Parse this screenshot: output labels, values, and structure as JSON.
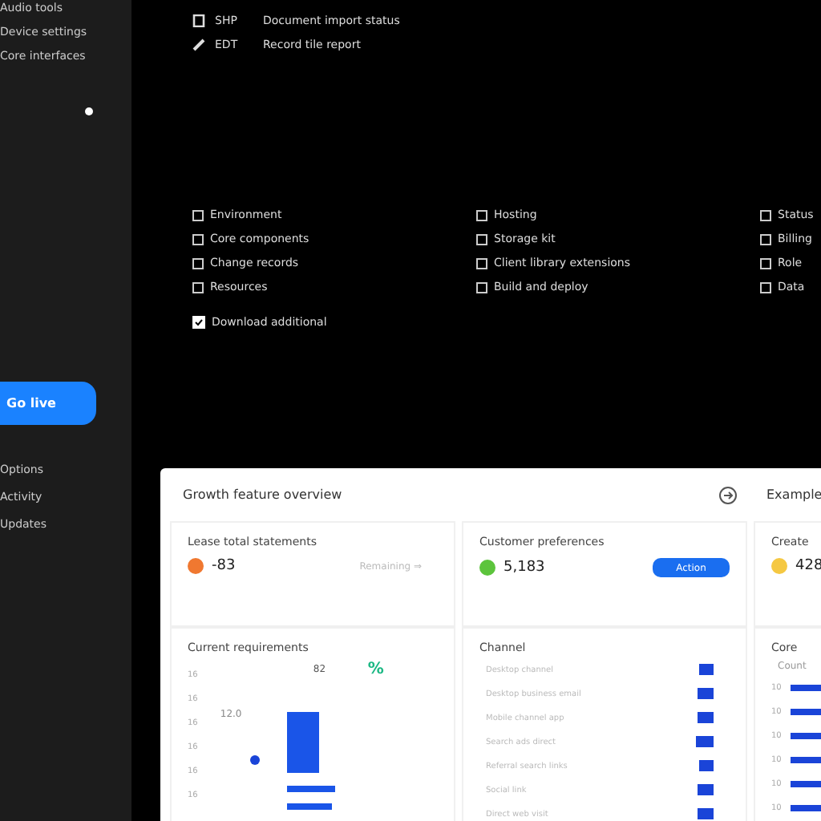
{
  "sidebar": {
    "top_items": [
      "Audio tools",
      "Device settings",
      "Core interfaces"
    ],
    "primary_button": "Go live",
    "bottom_items": [
      "Options",
      "Activity",
      "Updates"
    ]
  },
  "header_rows": [
    {
      "kind": "doc",
      "code": "SHP",
      "label": "Document import status"
    },
    {
      "kind": "edit",
      "code": "EDT",
      "label": "Record tile report"
    }
  ],
  "link_columns": [
    [
      "Environment",
      "Core components",
      "Change records",
      "Resources"
    ],
    [
      "Hosting",
      "Storage kit",
      "Client library extensions",
      "Build and deploy"
    ],
    [
      "Status",
      "Billing",
      "Role",
      "Data"
    ]
  ],
  "option": {
    "label": "Download additional",
    "checked": true
  },
  "panel": {
    "title": "Growth feature overview",
    "side_title": "Example",
    "cards": [
      {
        "title": "Lease total statements",
        "value": "-83",
        "color": "#f07830",
        "kind": "link",
        "action": "Remaining ⇒"
      },
      {
        "title": "Customer preferences",
        "value": "5,183",
        "color": "#5cc43c",
        "kind": "button",
        "action": "Action"
      },
      {
        "title": "Create",
        "value": "428",
        "color": "#f5c842",
        "kind": "none"
      }
    ],
    "sections": [
      {
        "kind": "chart",
        "title": "Current requirements",
        "badge": "%",
        "axis": [
          "16",
          "16",
          "16",
          "16",
          "16",
          "16"
        ],
        "marker": "82",
        "side_value": "12.0"
      },
      {
        "kind": "list",
        "title": "Channel",
        "rows": [
          "Desktop channel",
          "Desktop business email",
          "Mobile channel app",
          "Search ads direct",
          "Referral search links",
          "Social link",
          "Direct web visit"
        ]
      },
      {
        "kind": "bars",
        "title": "Core",
        "subtitle": "Count",
        "axis": [
          "10",
          "10",
          "10",
          "10",
          "10",
          "10"
        ]
      }
    ]
  }
}
